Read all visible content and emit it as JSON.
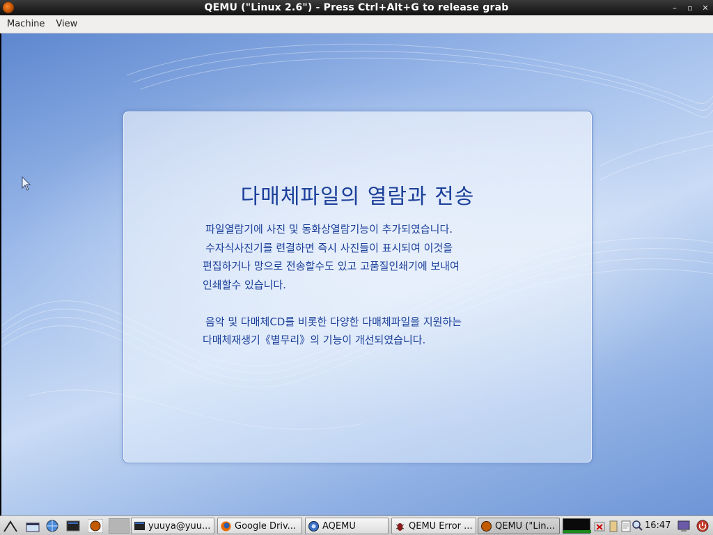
{
  "window": {
    "title": "QEMU (\"Linux 2.6\") - Press Ctrl+Alt+G to release grab",
    "buttons": [
      "minimize",
      "maximize",
      "close"
    ]
  },
  "menubar": {
    "items": [
      "Machine",
      "View"
    ]
  },
  "guest": {
    "heading": "다매체파일의 열람과 전송",
    "paragraph1": [
      "파일열람기에 사진 및 동화상열람기능이 추가되였습니다.",
      "수자식사진기를 련결하면 즉시 사진들이 표시되여 이것을",
      "편집하거나 망으로 전송할수도 있고 고품질인쇄기에 보내여",
      "인쇄할수 있습니다."
    ],
    "paragraph2": [
      "음악 및 다매체CD를 비롯한 다양한 다매체파일을 지원하는",
      "다매체재생기《별무리》의 기능이 개선되였습니다."
    ]
  },
  "taskbar": {
    "launchers": [
      "start-menu-icon",
      "show-desktop-icon",
      "network-icon",
      "terminal-launcher-icon",
      "qemu-launcher-icon"
    ],
    "tasks": [
      {
        "label": "yuuya@yuu...",
        "icon": "terminal-icon"
      },
      {
        "label": "Google Driv...",
        "icon": "firefox-icon"
      },
      {
        "label": "AQEMU",
        "icon": "aqemu-icon"
      },
      {
        "label": "QEMU Error ...",
        "icon": "bug-icon"
      },
      {
        "label": "QEMU (\"Lin...",
        "icon": "qemu-icon"
      }
    ],
    "clock": "16:47"
  },
  "colors": {
    "heading": "#1b3f9a",
    "title_bar": "#1e1e1e",
    "desktop": "#8fb0e4"
  }
}
